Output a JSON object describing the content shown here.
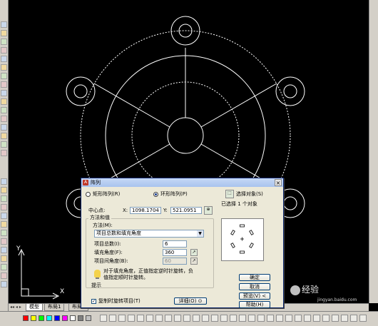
{
  "canvas": {
    "ucs": {
      "x_label": "X",
      "y_label": "Y"
    }
  },
  "model_tabs": [
    "模型",
    "布局1",
    "布局2"
  ],
  "dialog": {
    "title": "阵列",
    "close": "×",
    "radio_rect": "矩形阵列(R)",
    "radio_polar": "环形阵列(P)",
    "select_objects_label": "选择对象(S)",
    "selected_count_text": "已选择 1 个对象",
    "center_label": "中心点:",
    "center_x_label": "X:",
    "center_x": "1098.1704",
    "center_y_label": "Y:",
    "center_y": "521.0951",
    "method_group_label": "方法和值",
    "method_label": "方法(M):",
    "method_value": "项目总数和填充角度",
    "total_items_label": "项目总数(I):",
    "total_items": "6",
    "fill_angle_label": "填充角度(F):",
    "fill_angle": "360",
    "item_angle_label": "项目间角度(B):",
    "item_angle": "60",
    "tip_text_1": "对于填充角度，正值指定逆时针旋转，负",
    "tip_text_2": "值指定顺时针旋转。",
    "tip_label": "提示",
    "rotate_label": "复制时旋转项目(T)",
    "more_label": "详细(O)",
    "ok": "确定",
    "cancel": "取消",
    "preview": "预览(V) <",
    "help": "帮助(H)"
  },
  "watermark": {
    "brand": "经验",
    "url": "jingyan.baidu.com"
  },
  "colors": {
    "canvas_bg": "#000000",
    "lines": "#ffffff",
    "chrome": "#d4d0c8",
    "dialog": "#ece9d8"
  }
}
